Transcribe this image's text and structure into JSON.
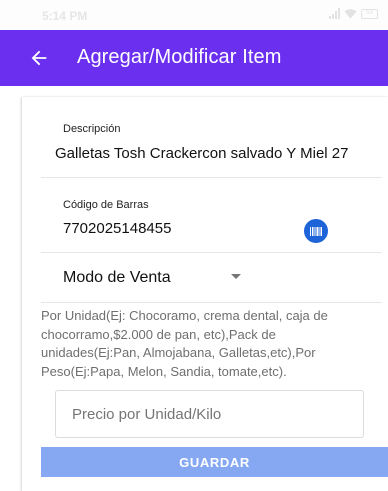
{
  "status_bar": {
    "time": "5:14 PM",
    "battery": "53"
  },
  "app_bar": {
    "title": "Agregar/Modificar Item",
    "back_icon": "arrow-left-icon",
    "color": "#6b2ff0"
  },
  "form": {
    "descripcion": {
      "label": "Descripción",
      "value": "Galletas Tosh Crackercon salvado Y Miel 27"
    },
    "codigo_barras": {
      "label": "Código de Barras",
      "value": "7702025148455",
      "scan_icon": "barcode-icon"
    },
    "modo_venta": {
      "label": "Modo de Venta",
      "dropdown_icon": "caret-down-icon"
    },
    "help_text": "Por Unidad(Ej: Chocoramo, crema dental, caja de chocorramo,$2.000 de pan, etc),Pack de unidades(Ej:Pan, Almojabana, Galletas,etc),Por Peso(Ej:Papa, Melon, Sandia, tomate,etc).",
    "precio": {
      "placeholder": "Precio por Unidad/Kilo",
      "value": ""
    },
    "save_label": "GUARDAR"
  }
}
